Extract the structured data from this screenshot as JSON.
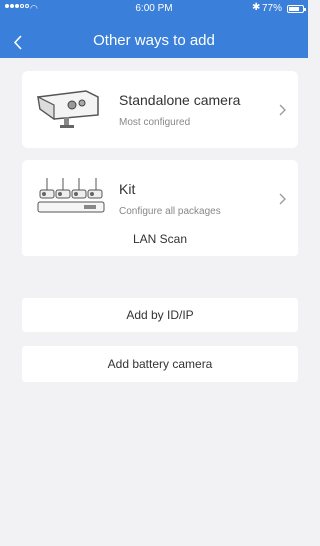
{
  "status_bar": {
    "time": "6:00 PM",
    "battery_percent": "77%",
    "battery_level": 0.77,
    "signal_icon": "signal-dots-icon",
    "wifi_icon": "wifi-icon",
    "bluetooth_icon": "bluetooth-icon"
  },
  "nav": {
    "title": "Other ways to add",
    "back_icon": "chevron-left-icon"
  },
  "options": [
    {
      "title": "Standalone camera",
      "subtitle": "Most configured",
      "icon": "bullet-camera-icon"
    },
    {
      "title": "Kit",
      "subtitle": "Configure all packages",
      "icon": "camera-kit-icon"
    }
  ],
  "buttons": {
    "lan_scan": "LAN Scan",
    "add_by_id": "Add by ID/IP",
    "add_battery": "Add battery camera"
  },
  "colors": {
    "header": "#3a7fd9",
    "background": "#f2f2f4",
    "card": "#ffffff"
  }
}
